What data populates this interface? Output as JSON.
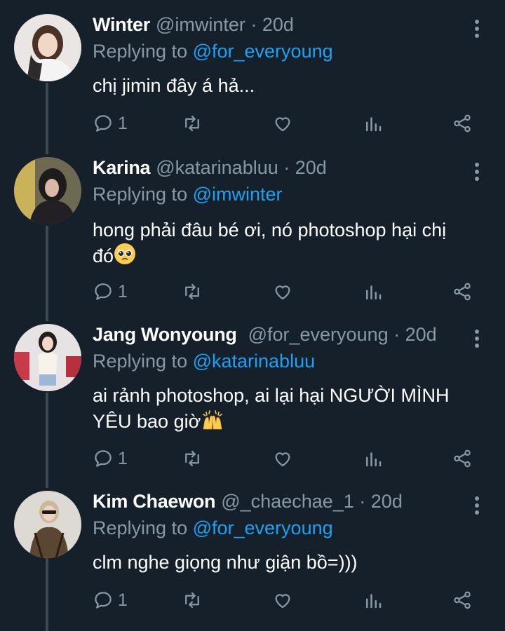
{
  "colors": {
    "background": "#15202b",
    "text": "#ffffff",
    "muted": "#8899a6",
    "link": "#1da1f2",
    "line": "#3d4a56"
  },
  "tweets": [
    {
      "name": "Winter",
      "handle": "@imwinter · 20d",
      "replying_prefix": "Replying to ",
      "replying_to": "@for_everyoung",
      "text": "chị jimin đây á hả...",
      "reply_count": "1"
    },
    {
      "name": "Karina",
      "handle": "@katarinabluu · 20d",
      "replying_prefix": "Replying to ",
      "replying_to": "@imwinter",
      "text_line1": "hong phải đâu bé ơi, nó photoshop hại chị",
      "text_line2": "đó",
      "emoji": "pleading-face",
      "reply_count": "1"
    },
    {
      "name": "Jang Wonyoung",
      "handle": "@for_everyoung · 20d",
      "replying_prefix": "Replying to ",
      "replying_to": "@katarinabluu",
      "text_line1": "ai rảnh photoshop, ai lại hại NGƯỜI MÌNH",
      "text_line2": "YÊU bao giờ",
      "emoji": "raising-hands",
      "reply_count": "1"
    },
    {
      "name": "Kim Chaewon",
      "handle": "@_chaechae_1 · 20d",
      "replying_prefix": "Replying to ",
      "replying_to": "@for_everyoung",
      "text": "clm nghe giọng như giận bồ=)))",
      "reply_count": "1"
    }
  ],
  "icons": [
    "reply-icon",
    "retweet-icon",
    "like-icon",
    "analytics-icon",
    "share-icon",
    "more-options-icon"
  ]
}
